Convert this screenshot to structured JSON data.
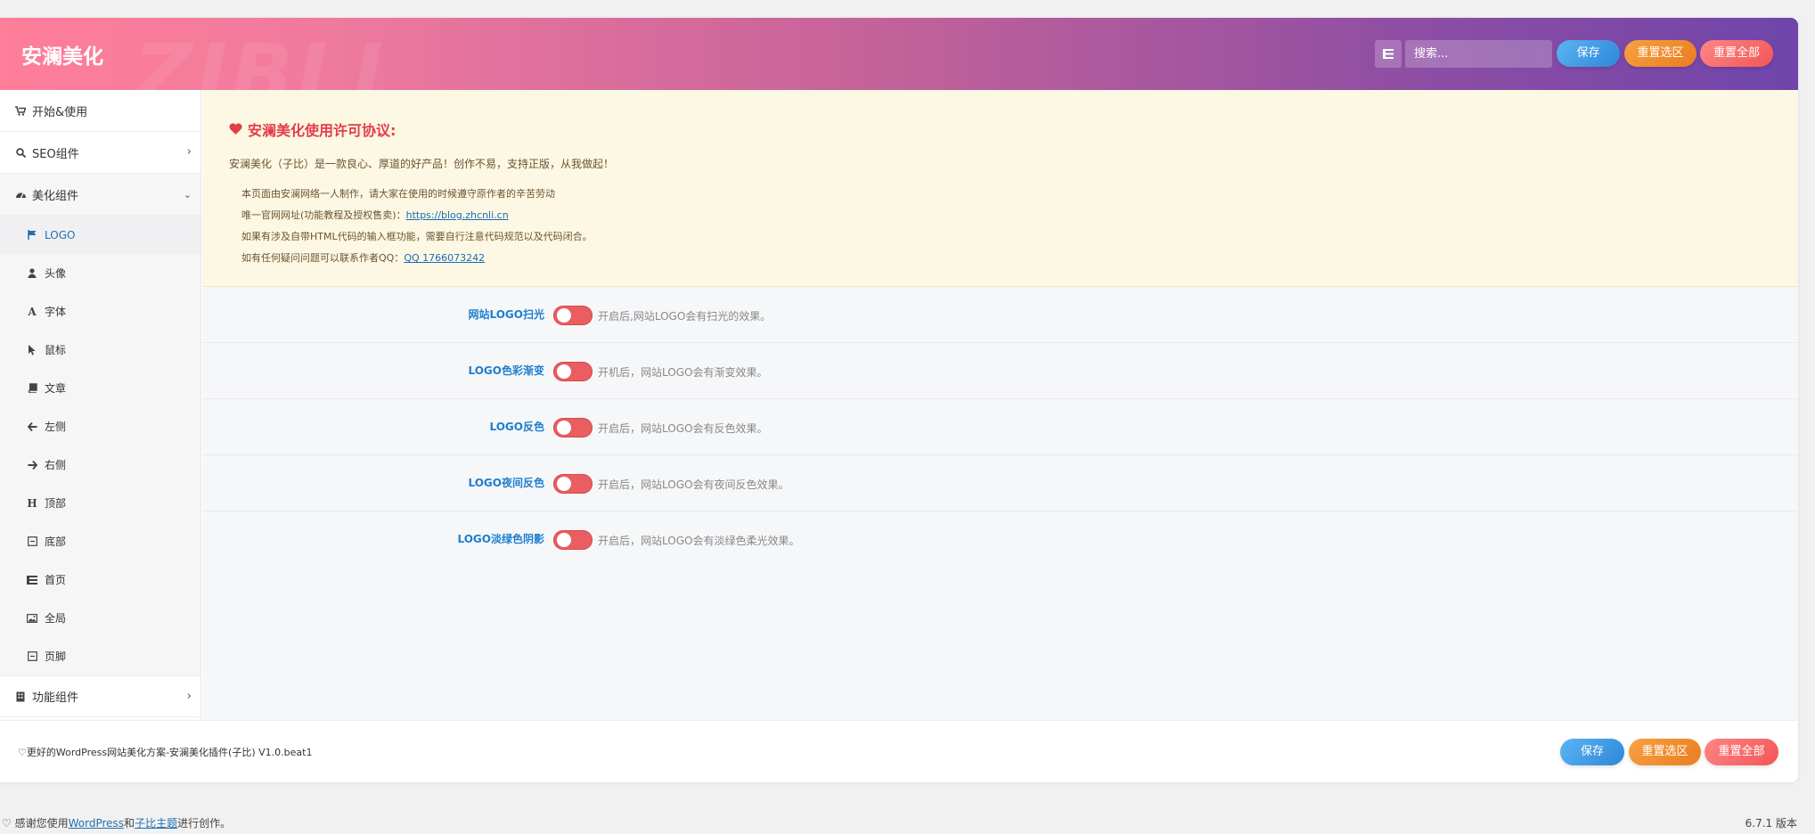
{
  "header": {
    "brand": "安澜美化",
    "watermark": "ZIBLL",
    "search_placeholder": "搜索...",
    "save": "保存",
    "reset_section": "重置选区",
    "reset_all": "重置全部"
  },
  "sidebar": {
    "start": "开始&使用",
    "seo": "SEO组件",
    "beautify": "美化组件",
    "function": "功能组件",
    "sub_items": [
      "LOGO",
      "头像",
      "字体",
      "鼠标",
      "文章",
      "左侧",
      "右侧",
      "顶部",
      "底部",
      "首页",
      "全局",
      "页脚"
    ]
  },
  "notice": {
    "title": "安澜美化使用许可协议:",
    "line1": "安澜美化（子比）是一款良心、厚道的好产品！创作不易，支持正版，从我做起！",
    "item1": "本页面由安澜网络一人制作，请大家在使用的时候遵守原作者的辛苦劳动",
    "item2_prefix": "唯一官网网址(功能教程及授权售卖)：",
    "item2_link": "https://blog.zhcnli.cn",
    "item3": "如果有涉及自带HTML代码的输入框功能，需要自行注意代码规范以及代码闭合。",
    "item4_prefix": "如有任何疑问问题可以联系作者QQ：",
    "item4_link": "QQ 1766073242"
  },
  "options": [
    {
      "label": "网站LOGO扫光",
      "desc": "开启后,网站LOGO会有扫光的效果。",
      "enabled": false
    },
    {
      "label": "LOGO色彩渐变",
      "desc": "开机后，网站LOGO会有渐变效果。",
      "enabled": false
    },
    {
      "label": "LOGO反色",
      "desc": "开启后，网站LOGO会有反色效果。",
      "enabled": false
    },
    {
      "label": "LOGO夜间反色",
      "desc": "开启后，网站LOGO会有夜间反色效果。",
      "enabled": false
    },
    {
      "label": "LOGO淡绿色阴影",
      "desc": "开启后，网站LOGO会有淡绿色柔光效果。",
      "enabled": false
    }
  ],
  "footer": {
    "text": "♡更好的WordPress网站美化方案-安澜美化插件(子比) V1.0.beat1",
    "save": "保存",
    "reset_section": "重置选区",
    "reset_all": "重置全部"
  },
  "wp_footer": {
    "thanks_prefix": "感谢您使用",
    "wordpress": "WordPress",
    "and": "和",
    "theme": "子比主题",
    "suffix": "进行创作。",
    "version": "6.7.1 版本"
  },
  "colors": {
    "header_start": "#ff7e9a",
    "header_end": "#6f45ab",
    "label_blue": "#1e7ecf",
    "toggle_off": "#ea5d60",
    "notice_bg": "#fdf8e4",
    "notice_title": "#e33d4a"
  }
}
